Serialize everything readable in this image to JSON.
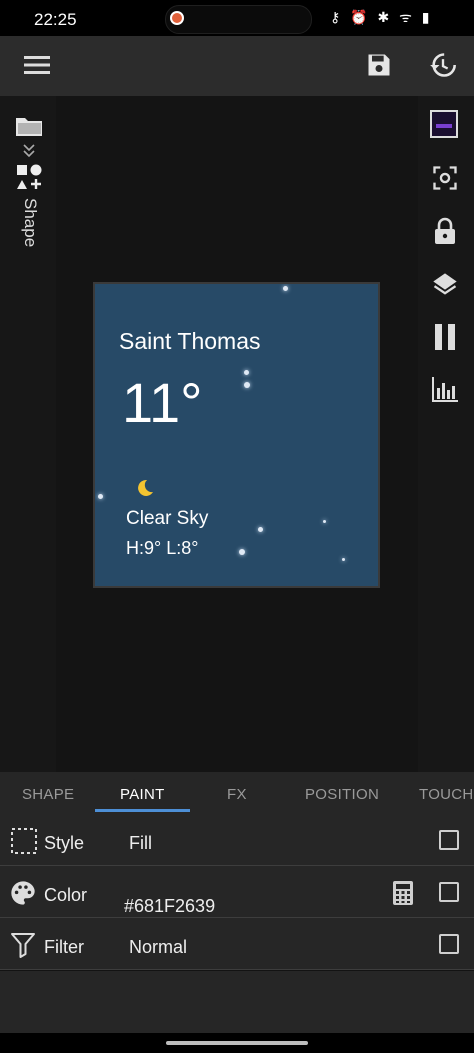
{
  "status_bar": {
    "time": "22:25",
    "icons": "⚷ ⏰ ✱ ᯤ ▮"
  },
  "toolbar": {
    "menu_icon": "menu-icon",
    "save_icon": "save-icon",
    "history_icon": "history-icon"
  },
  "left_panel": {
    "folder_icon": "folder-icon",
    "expand_icon": "double-chevron-down-icon",
    "shape_label": "Shape"
  },
  "right_panel": [
    "thumbnail",
    "focus-icon",
    "lock-icon",
    "layers-icon",
    "pause-icon",
    "equalizer-icon"
  ],
  "widget": {
    "city": "Saint Thomas",
    "temperature": "11°",
    "condition": "Clear Sky",
    "hi_lo": "H:9° L:8°",
    "background_color": "#274a67"
  },
  "tabs": {
    "items": [
      {
        "label": "SHAPE",
        "active": false
      },
      {
        "label": "PAINT",
        "active": true
      },
      {
        "label": "FX",
        "active": false
      },
      {
        "label": "POSITION",
        "active": false
      },
      {
        "label": "TOUCH",
        "active": false
      }
    ]
  },
  "properties": {
    "style": {
      "label": "Style",
      "value": "Fill"
    },
    "color": {
      "label": "Color",
      "value": "#681F2639"
    },
    "filter": {
      "label": "Filter",
      "value": "Normal"
    }
  },
  "colors": {
    "accent": "#4d8fd6",
    "toolbar": "#2c2c2c",
    "panel": "#262626"
  }
}
